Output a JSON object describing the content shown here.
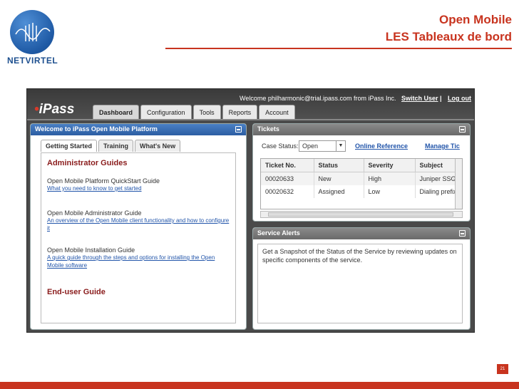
{
  "slide": {
    "logo_name": "NETVIRTEL",
    "title_line1": "Open Mobile",
    "title_line2": "LES Tableaux de bord",
    "page_number": "21"
  },
  "app": {
    "brand": "iPass",
    "welcome": "Welcome philharmonic@trial.ipass.com from iPass Inc.",
    "switch_user": "Switch User",
    "separator": "|",
    "logout": "Log out",
    "tabs": [
      "Dashboard",
      "Configuration",
      "Tools",
      "Reports",
      "Account"
    ],
    "active_tab": "Dashboard"
  },
  "welcome_panel": {
    "title": "Welcome to iPass Open Mobile Platform",
    "subtabs": [
      "Getting Started",
      "Training",
      "What's New"
    ],
    "admin_heading": "Administrator Guides",
    "guides": [
      {
        "title": "Open Mobile Platform QuickStart Guide",
        "link": "What you need to know to get started"
      },
      {
        "title": "Open Mobile Administrator Guide",
        "link": "An overview of the Open Mobile client functionality and how to configure it"
      },
      {
        "title": "Open Mobile Installation Guide",
        "link": "A quick guide through the steps and options for installing the Open Mobile software"
      }
    ],
    "enduser_heading": "End-user Guide"
  },
  "tickets_panel": {
    "title": "Tickets",
    "case_status_label": "Case Status:",
    "case_status_value": "Open",
    "online_reference": "Online Reference",
    "manage_tickets": "Manage Tic",
    "columns": [
      "Ticket No.",
      "Status",
      "Severity",
      "Subject"
    ],
    "rows": [
      [
        "00020633",
        "New",
        "High",
        "Juniper SSG"
      ],
      [
        "00020632",
        "Assigned",
        "Low",
        "Dialing prefix"
      ]
    ]
  },
  "alerts_panel": {
    "title": "Service Alerts",
    "body": "Get a Snapshot of the Status of the Service by reviewing updates on specific components of the service."
  }
}
